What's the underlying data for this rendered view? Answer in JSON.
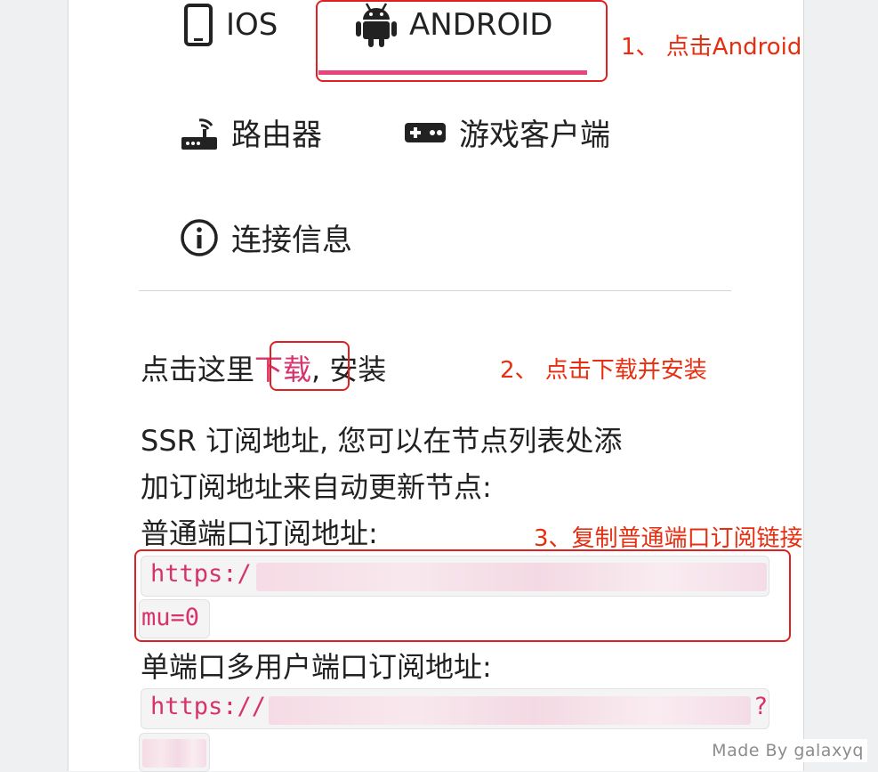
{
  "tabs": {
    "ios": "IOS",
    "android": "ANDROID",
    "router": "路由器",
    "game_client": "游戏客户端",
    "connection_info": "连接信息"
  },
  "accent_color": "#e8457a",
  "annotation_color": "#e82e10",
  "download": {
    "prefix": "点击这里",
    "link": "下载",
    "suffix": ", 安装"
  },
  "description": {
    "line1": "SSR 订阅地址, 您可以在节点列表处添",
    "line2": "加订阅地址来自动更新节点:"
  },
  "normal_port": {
    "label": "普通端口订阅地址:",
    "url_start": "https:/",
    "url_end": "mu=0"
  },
  "single_port": {
    "label": "单端口多用户端口订阅地址:",
    "url_start": "https://",
    "url_tail": "?"
  },
  "annotations": {
    "step1": "1、 点击Android",
    "step2": "2、 点击下载并安装",
    "step3": "3、复制普通端口订阅链接"
  },
  "watermark": "Made By galaxyq"
}
